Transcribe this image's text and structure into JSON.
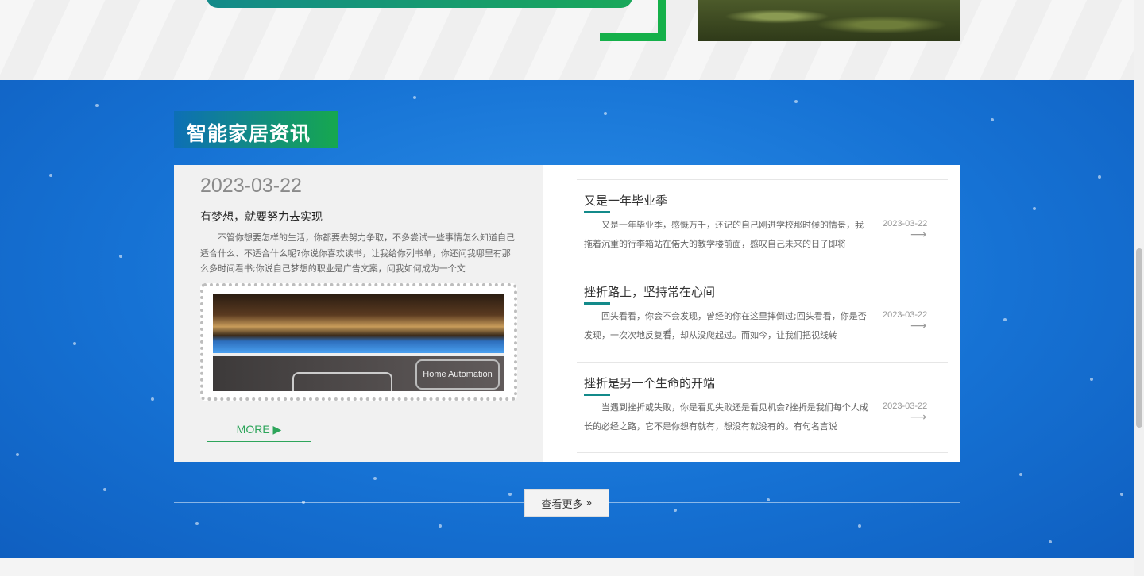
{
  "section": {
    "title": "智能家居资讯"
  },
  "featured": {
    "date": "2023-03-22",
    "title": "有梦想，就要努力去实现",
    "excerpt": "不管你想要怎样的生活，你都要去努力争取，不多尝试一些事情怎么知道自己适合什么、不适合什么呢?你说你喜欢读书，让我给你列书单，你还问我哪里有那么多时间看书;你说自己梦想的职业是广告文案，问我如何成为一个文",
    "image_caption": "Home Automation",
    "more_label": "MORE ▶"
  },
  "news": [
    {
      "title": "又是一年毕业季",
      "excerpt": "又是一年毕业季，感慨万千，还记的自己刚进学校那时候的情景，我拖着沉重的行李箱站在偌大的教学楼前面，感叹自己未来的日子即将",
      "date": "2023-03-22",
      "arrow": "⟶"
    },
    {
      "title": "挫折路上，坚持常在心间",
      "excerpt": "回头看看，你会不会发现，曾经的你在这里摔倒过;回头看看，你是否发现，一次次地反复看，却从没爬起过。而如今，让我们把视线转",
      "date": "2023-03-22",
      "arrow": "⟶"
    },
    {
      "title": "挫折是另一个生命的开端",
      "excerpt": "当遇到挫折或失败，你是看见失败还是看见机会?挫折是我们每个人成长的必经之路，它不是你想有就有，想没有就没有的。有句名言说",
      "date": "2023-03-22",
      "arrow": "⟶"
    }
  ],
  "view_more": {
    "label": "查看更多",
    "icon": "»"
  },
  "colors": {
    "blue_bg": "#1672d4",
    "accent_green": "#16a84e",
    "accent_teal": "#138a8a"
  }
}
